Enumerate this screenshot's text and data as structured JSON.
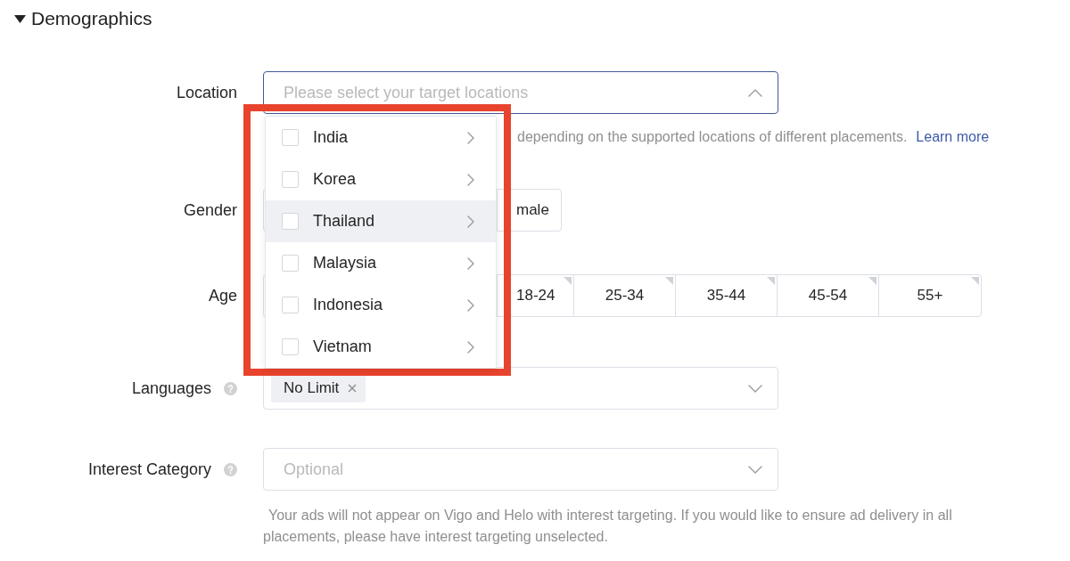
{
  "section": {
    "title": "Demographics",
    "expanded": true
  },
  "location": {
    "label": "Location",
    "placeholder": "Please select your target locations",
    "focused": true,
    "open": true,
    "helper": "depending on the supported locations of different placements.",
    "helper_link": "Learn more",
    "dropdown": {
      "outlined": true,
      "items": [
        {
          "label": "India",
          "checked": false,
          "highlighted": false
        },
        {
          "label": "Korea",
          "checked": false,
          "highlighted": false
        },
        {
          "label": "Thailand",
          "checked": false,
          "highlighted": true
        },
        {
          "label": "Malaysia",
          "checked": false,
          "highlighted": false
        },
        {
          "label": "Indonesia",
          "checked": false,
          "highlighted": false
        },
        {
          "label": "Vietnam",
          "checked": false,
          "highlighted": false
        }
      ]
    }
  },
  "gender": {
    "label": "Gender",
    "options": [
      {
        "label": "male",
        "selected": false
      }
    ]
  },
  "age": {
    "label": "Age",
    "options": [
      {
        "label": "18-24",
        "selected": false
      },
      {
        "label": "25-34",
        "selected": false
      },
      {
        "label": "35-44",
        "selected": false
      },
      {
        "label": "45-54",
        "selected": false
      },
      {
        "label": "55+",
        "selected": false
      }
    ]
  },
  "languages": {
    "label": "Languages",
    "help": true,
    "tags": [
      {
        "label": "No Limit",
        "removable": true
      }
    ]
  },
  "interest": {
    "label": "Interest Category",
    "help": true,
    "placeholder": "Optional",
    "note": "Your ads will not appear on Vigo and Helo with interest targeting. If you would like to ensure ad delivery in all placements, please have interest targeting unselected."
  }
}
